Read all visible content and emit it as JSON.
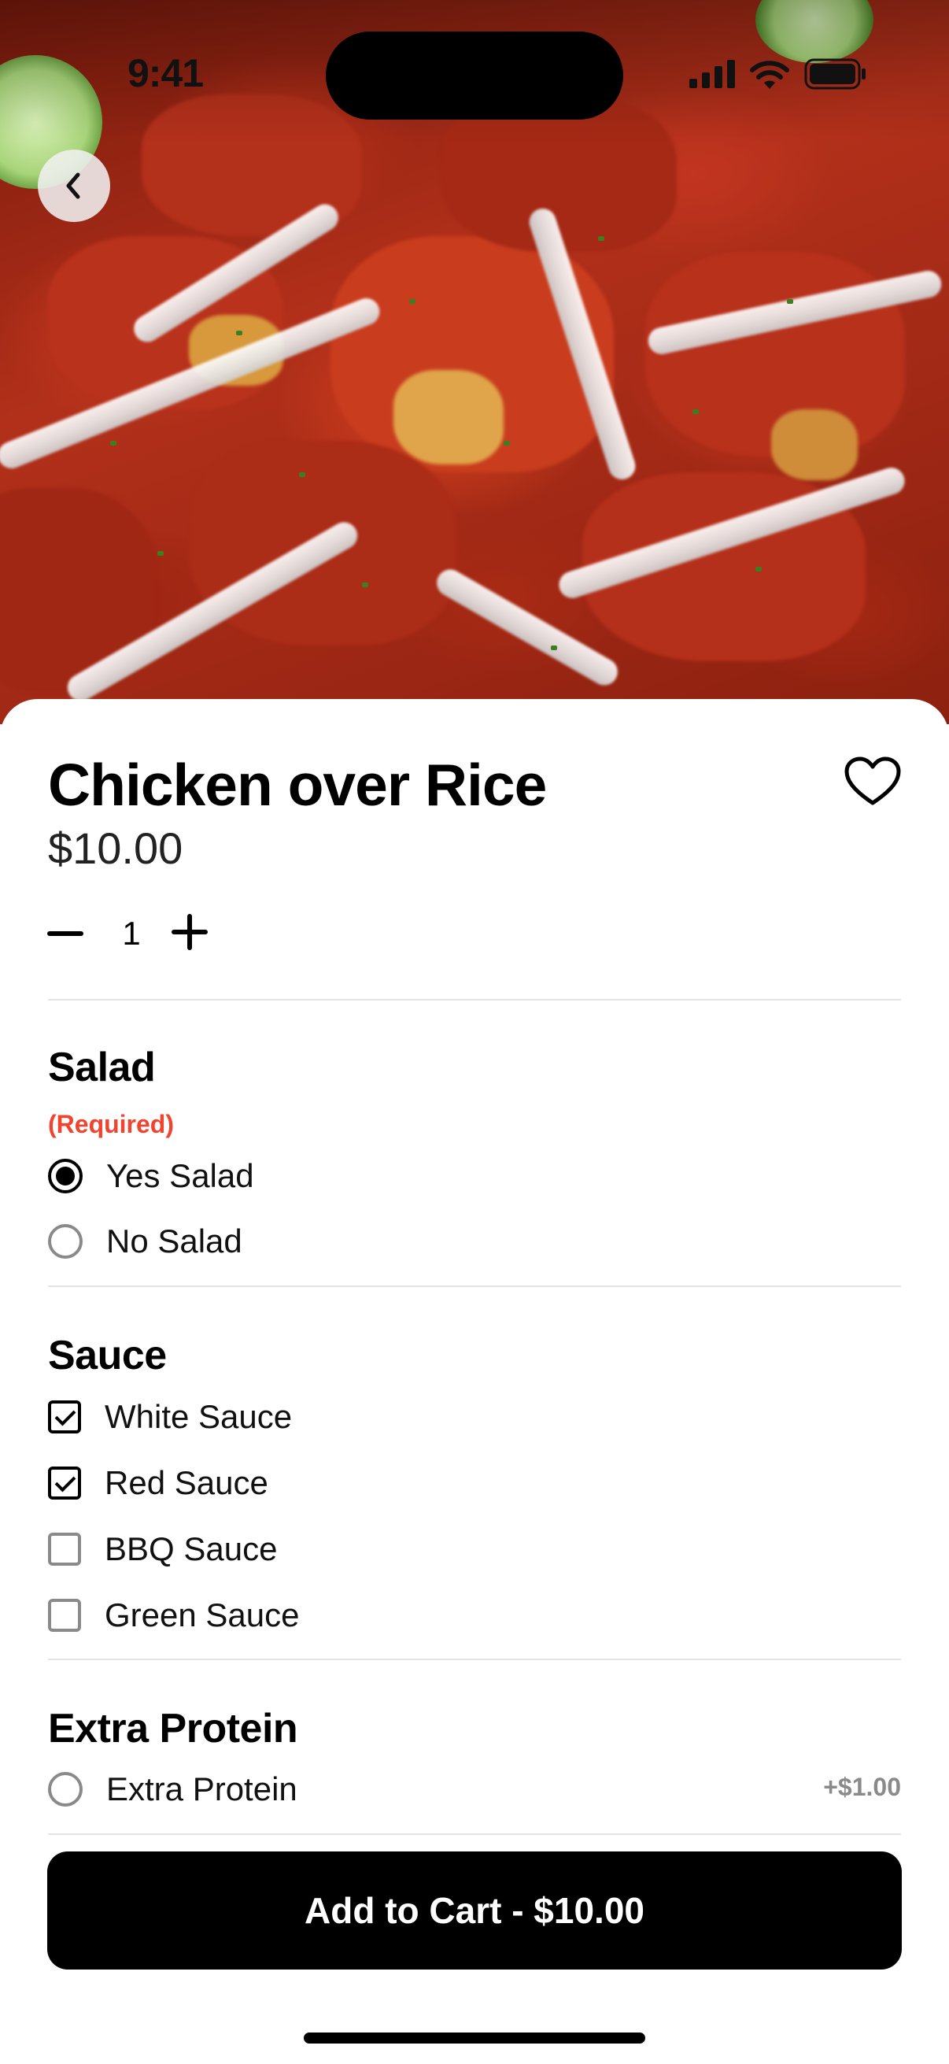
{
  "status_bar": {
    "time": "9:41"
  },
  "product": {
    "title": "Chicken over Rice",
    "price": "$10.00",
    "quantity": "1"
  },
  "salad": {
    "title": "Salad",
    "required_label": "(Required)",
    "options": [
      {
        "label": "Yes Salad",
        "selected": true
      },
      {
        "label": "No Salad",
        "selected": false
      }
    ]
  },
  "sauce": {
    "title": "Sauce",
    "options": [
      {
        "label": "White Sauce",
        "checked": true
      },
      {
        "label": "Red Sauce",
        "checked": true
      },
      {
        "label": "BBQ Sauce",
        "checked": false
      },
      {
        "label": "Green Sauce",
        "checked": false
      }
    ]
  },
  "extra_protein": {
    "title": "Extra Protein",
    "options": [
      {
        "label": "Extra Protein",
        "price": "+$1.00",
        "selected": false
      }
    ]
  },
  "cart_button": {
    "label": "Add to Cart - $10.00"
  },
  "icons": {
    "back": "chevron-left-icon",
    "favorite": "heart-icon",
    "signal": "cellular-signal-icon",
    "wifi": "wifi-icon",
    "battery": "battery-icon"
  },
  "colors": {
    "accent_required": "#f0442f",
    "primary": "#000000",
    "muted": "#8a8a8a"
  }
}
